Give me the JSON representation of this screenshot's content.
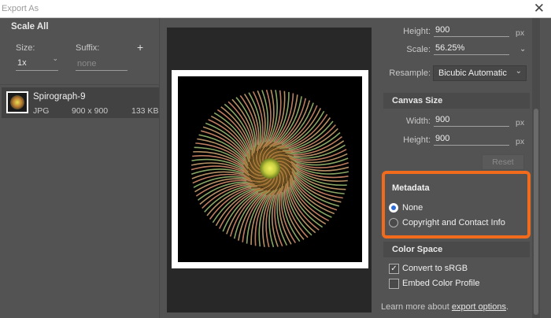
{
  "window": {
    "title": "Export As",
    "close_glyph": "✕"
  },
  "left_panel": {
    "heading": "Scale All",
    "size_label": "Size:",
    "suffix_label": "Suffix:",
    "add_glyph": "+",
    "size_value": "1x",
    "suffix_placeholder": "none",
    "asset": {
      "name": "Spirograph-9",
      "format": "JPG",
      "dimensions": "900 x 900",
      "file_size": "133 KB"
    }
  },
  "image_size": {
    "height_label": "Height:",
    "height_value": "900",
    "height_unit": "px",
    "scale_label": "Scale:",
    "scale_value": "56.25%",
    "resample_label": "Resample:",
    "resample_value": "Bicubic Automatic"
  },
  "canvas_size": {
    "heading": "Canvas Size",
    "width_label": "Width:",
    "width_value": "900",
    "width_unit": "px",
    "height_label": "Height:",
    "height_value": "900",
    "height_unit": "px",
    "reset_label": "Reset"
  },
  "metadata": {
    "heading": "Metadata",
    "options": [
      "None",
      "Copyright and Contact Info"
    ],
    "selected": "None",
    "highlight_color": "#f26b1d"
  },
  "color_space": {
    "heading": "Color Space",
    "convert_label": "Convert to sRGB",
    "convert_checked": true,
    "embed_label": "Embed Color Profile",
    "embed_checked": false
  },
  "footer": {
    "text": "Learn more about ",
    "link": "export options",
    "suffix": "."
  }
}
